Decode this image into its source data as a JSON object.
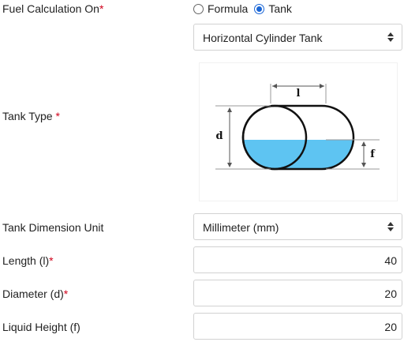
{
  "fuel_calc": {
    "label": "Fuel Calculation On",
    "required_mark": "*",
    "options": [
      {
        "label": "Formula",
        "checked": false
      },
      {
        "label": "Tank",
        "checked": true
      }
    ]
  },
  "tank_type": {
    "label": "Tank Type",
    "required_mark": "*",
    "selected": "Horizontal Cylinder Tank",
    "diagram": {
      "length_symbol": "l",
      "diameter_symbol": "d",
      "fill_symbol": "f",
      "liquid_color": "#5ec4f2"
    }
  },
  "dimension_unit": {
    "label": "Tank Dimension Unit",
    "selected": "Millimeter (mm)"
  },
  "length": {
    "label": "Length (l)",
    "required_mark": "*",
    "value": "40"
  },
  "diameter": {
    "label": "Diameter (d)",
    "required_mark": "*",
    "value": "20"
  },
  "liquid_height": {
    "label": "Liquid Height (f)",
    "value": "20"
  }
}
